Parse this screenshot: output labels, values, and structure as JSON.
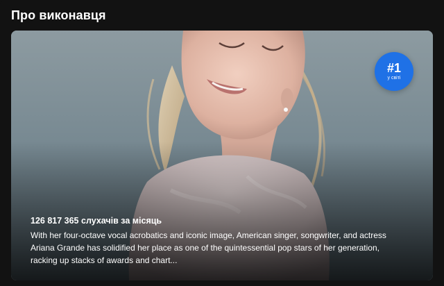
{
  "section": {
    "title": "Про виконавця"
  },
  "artist": {
    "rank": {
      "number": "#1",
      "label": "у світі",
      "color": "#1f71e6"
    },
    "monthly_listeners": "126 817 365 слухачів за місяць",
    "bio": "With her four-octave vocal acrobatics and iconic image, American singer, songwriter, and actress Ariana Grande has solidified her place as one of the quintessential pop stars of her generation, racking up stacks of awards and chart..."
  },
  "colors": {
    "background": "#121212",
    "photo_backdrop": "#73838b"
  }
}
